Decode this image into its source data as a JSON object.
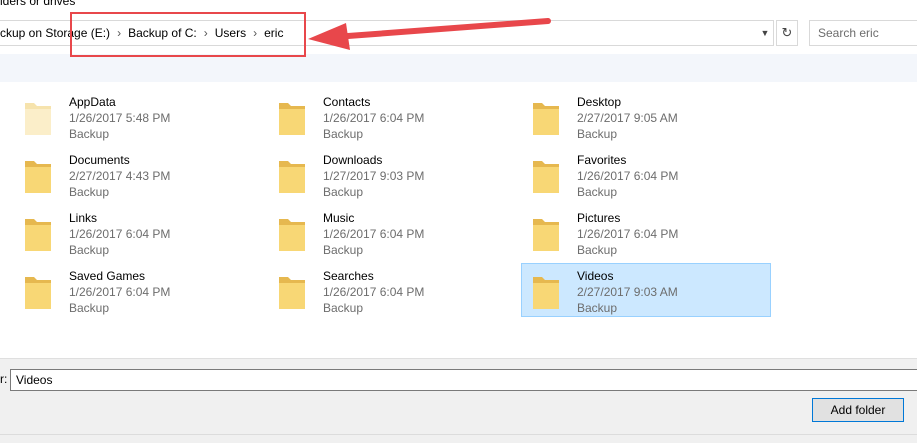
{
  "window": {
    "title_fragment": "lders or drives"
  },
  "address_bar": {
    "crumbs": [
      "ckup on Storage (E:)",
      "Backup of C:",
      "Users",
      "eric"
    ],
    "separator": "›"
  },
  "search": {
    "placeholder": "Search eric"
  },
  "items": [
    {
      "name": "AppData",
      "date": "1/26/2017 5:48 PM",
      "type": "Backup",
      "icon": "folder-hidden-icon",
      "selected": false
    },
    {
      "name": "Contacts",
      "date": "1/26/2017 6:04 PM",
      "type": "Backup",
      "icon": "folder-icon",
      "selected": false
    },
    {
      "name": "Desktop",
      "date": "2/27/2017 9:05 AM",
      "type": "Backup",
      "icon": "folder-icon",
      "selected": false
    },
    {
      "name": "Documents",
      "date": "2/27/2017 4:43 PM",
      "type": "Backup",
      "icon": "folder-icon",
      "selected": false
    },
    {
      "name": "Downloads",
      "date": "1/27/2017 9:03 PM",
      "type": "Backup",
      "icon": "folder-icon",
      "selected": false
    },
    {
      "name": "Favorites",
      "date": "1/26/2017 6:04 PM",
      "type": "Backup",
      "icon": "folder-icon",
      "selected": false
    },
    {
      "name": "Links",
      "date": "1/26/2017 6:04 PM",
      "type": "Backup",
      "icon": "folder-icon",
      "selected": false
    },
    {
      "name": "Music",
      "date": "1/26/2017 6:04 PM",
      "type": "Backup",
      "icon": "folder-icon",
      "selected": false
    },
    {
      "name": "Pictures",
      "date": "1/26/2017 6:04 PM",
      "type": "Backup",
      "icon": "folder-icon",
      "selected": false
    },
    {
      "name": "Saved Games",
      "date": "1/26/2017 6:04 PM",
      "type": "Backup",
      "icon": "folder-icon",
      "selected": false
    },
    {
      "name": "Searches",
      "date": "1/26/2017 6:04 PM",
      "type": "Backup",
      "icon": "folder-icon",
      "selected": false
    },
    {
      "name": "Videos",
      "date": "2/27/2017 9:03 AM",
      "type": "Backup",
      "icon": "folder-icon",
      "selected": true
    }
  ],
  "folder_field": {
    "label": "r:",
    "value": "Videos"
  },
  "buttons": {
    "add_folder": "Add folder"
  },
  "colors": {
    "selection_bg": "#cce8ff",
    "selection_border": "#99d1ff",
    "annotation_red": "#e8474b",
    "folder_yellow": "#f8d775"
  }
}
